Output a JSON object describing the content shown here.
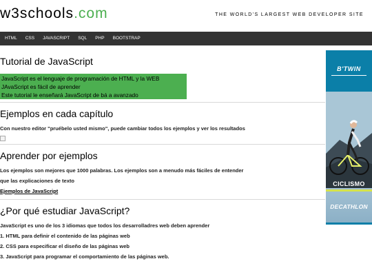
{
  "header": {
    "logo_main": "w3schools",
    "logo_suffix": ".com",
    "tagline": "THE WORLD'S LARGEST WEB DEVELOPER SITE"
  },
  "nav": {
    "items": [
      {
        "label": "HTML"
      },
      {
        "label": "CSS"
      },
      {
        "label": "JAVASCRIPT"
      },
      {
        "label": "SQL"
      },
      {
        "label": "PHP"
      },
      {
        "label": "BOOTSTRAP"
      }
    ]
  },
  "sections": {
    "tutorial": {
      "title": "Tutorial de JavaScript",
      "lines": [
        "JavaScript es el lenguaje de programación de HTML y la WEB",
        "JAvaScript es fácil de aprender",
        "Este tutorial le enseñará JavaScript de bá a avanzado"
      ]
    },
    "examples_each": {
      "title": "Ejemplos en cada capítulo",
      "text": "Con nuestro editor \"pruébelo usted mismo\", puede cambiar todos los ejemplos y ver los resultados"
    },
    "learn_by_examples": {
      "title": "Aprender por ejemplos",
      "text_line1": "Los ejemplos son mejores que 1000 palabras. Los ejemplos son a menudo más fáciles de entender",
      "text_line2": "que las explicaciones de texto",
      "link": "Ejemplos de JavaScript"
    },
    "why": {
      "title": "¿Por qué estudiar JavaScript?",
      "intro": "JavaScript es uno de los 3 idiomas que todos los desarrolladres web deben aprender",
      "items": [
        "1. HTML para definir el contenido de las páginas web",
        "2. CSS para especificar el diseño de las páginas web",
        "3. JavaScript para programar el comportamiento de las páginas web."
      ]
    }
  },
  "ad": {
    "brand": "B'TWIN",
    "sport": "CICLISMO",
    "retailer": "DECATHLON"
  },
  "colors": {
    "accent_green": "#4CAF50",
    "navbar_bg": "#333333",
    "ad_blue": "#0b7fa8"
  }
}
